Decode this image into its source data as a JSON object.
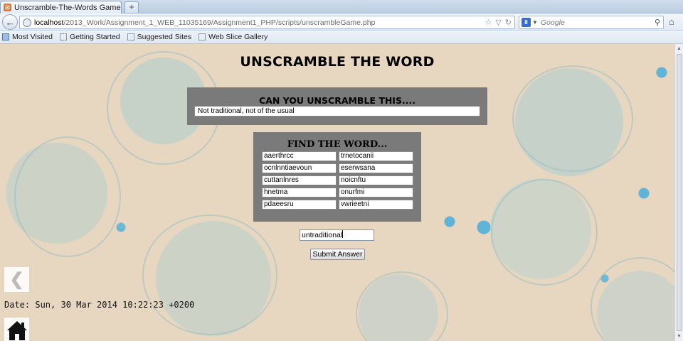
{
  "browser": {
    "tab_title": "Unscramble-The-Words Game",
    "new_tab_label": "+",
    "url_host": "localhost",
    "url_path": "/2013_Work/Assignment_1_WEB_11035169/Assignment1_PHP/scripts/unscrambleGame.php",
    "search_engine": "Google",
    "search_placeholder": "Google",
    "bookmarks": [
      "Most Visited",
      "Getting Started",
      "Suggested Sites",
      "Web Slice Gallery"
    ]
  },
  "page": {
    "title": "UNSCRAMBLE THE WORD",
    "clue_heading": "CAN YOU UNSCRAMBLE THIS....",
    "clue_text": "Not traditional, not of the usual",
    "find_heading": "FIND THE WORD...",
    "scrambled_words": [
      [
        "aaerthrcc",
        "trnetocanii"
      ],
      [
        "ocnlnntiaevoun",
        "eserwsana"
      ],
      [
        "cuttanlnres",
        "noicnftu"
      ],
      [
        "hnetma",
        "onurfmi"
      ],
      [
        "pdaeesru",
        "vwrieetni"
      ]
    ],
    "answer_value": "untraditional",
    "submit_label": "Submit Answer",
    "prev_arrow": "❮",
    "date_text": "Date: Sun, 30 Mar 2014 10:22:23 +0200"
  },
  "icons": {
    "back": "arrow-left-icon",
    "globe": "globe-icon",
    "home": "home-icon"
  },
  "colors": {
    "panel_gray": "#7a7a7a",
    "page_background": "#e7d7c0",
    "accent_dots": "#3caadc"
  }
}
